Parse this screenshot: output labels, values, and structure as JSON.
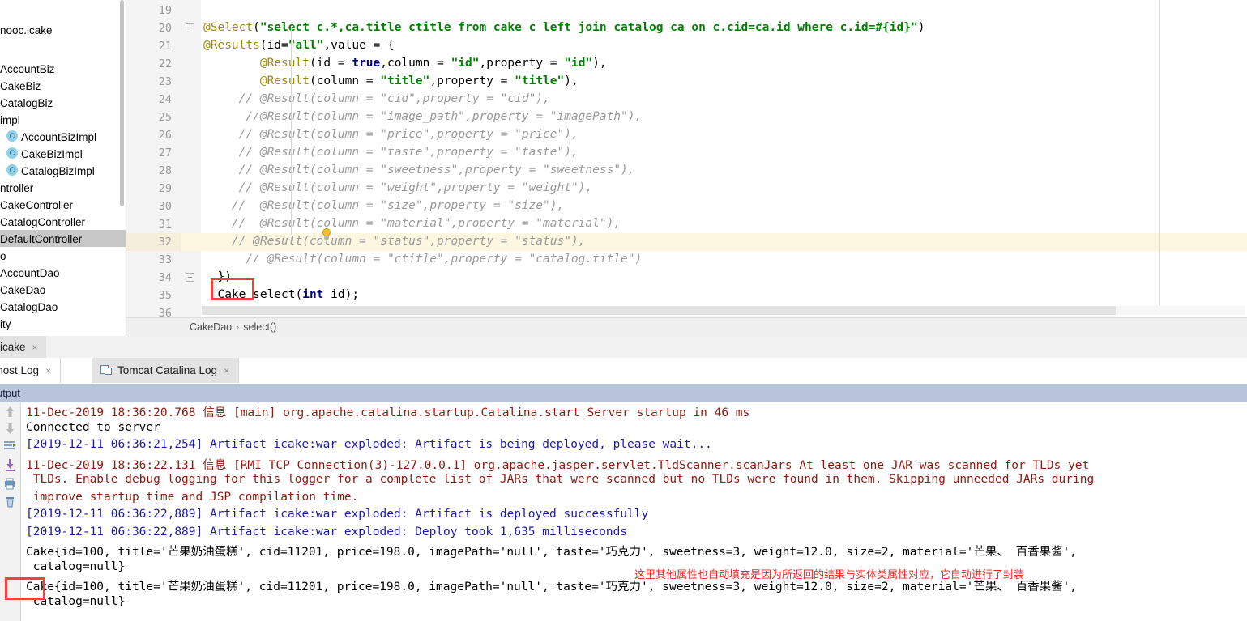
{
  "project_tree": {
    "scrollbar": "vertical-scrollbar",
    "items": [
      {
        "label": "nooc.icake",
        "icon": "",
        "selected": false,
        "indent": 0
      },
      {
        "label": "AccountBiz",
        "icon": "",
        "selected": false,
        "indent": 0
      },
      {
        "label": "CakeBiz",
        "icon": "",
        "selected": false,
        "indent": 0
      },
      {
        "label": "CatalogBiz",
        "icon": "",
        "selected": false,
        "indent": 0
      },
      {
        "label": "impl",
        "icon": "",
        "selected": false,
        "indent": 0
      },
      {
        "label": "AccountBizImpl",
        "icon": "C",
        "selected": false,
        "indent": 1
      },
      {
        "label": "CakeBizImpl",
        "icon": "C",
        "selected": false,
        "indent": 1
      },
      {
        "label": "CatalogBizImpl",
        "icon": "C",
        "selected": false,
        "indent": 1
      },
      {
        "label": "ntroller",
        "icon": "",
        "selected": false,
        "indent": 0
      },
      {
        "label": "CakeController",
        "icon": "",
        "selected": false,
        "indent": 0
      },
      {
        "label": "CatalogController",
        "icon": "",
        "selected": false,
        "indent": 0
      },
      {
        "label": "DefaultController",
        "icon": "",
        "selected": true,
        "indent": 0
      },
      {
        "label": "o",
        "icon": "",
        "selected": false,
        "indent": 0
      },
      {
        "label": "AccountDao",
        "icon": "",
        "selected": false,
        "indent": 0
      },
      {
        "label": "CakeDao",
        "icon": "",
        "selected": false,
        "indent": 0
      },
      {
        "label": "CatalogDao",
        "icon": "",
        "selected": false,
        "indent": 0
      },
      {
        "label": "ity",
        "icon": "",
        "selected": false,
        "indent": 0
      }
    ]
  },
  "editor": {
    "first_line_number": 19,
    "last_line_number": 36,
    "highlighted_line": 32,
    "line_numbers": [
      19,
      20,
      21,
      22,
      23,
      24,
      25,
      26,
      27,
      28,
      29,
      30,
      31,
      32,
      33,
      34,
      35,
      36
    ],
    "lines": [
      {
        "n": 19,
        "text": ""
      },
      {
        "n": 20,
        "text": "@Select(\"select c.*,ca.title ctitle from cake c left join catalog ca on c.cid=ca.id where c.id=#{id}\")"
      },
      {
        "n": 21,
        "text": "@Results(id=\"all\",value = {"
      },
      {
        "n": 22,
        "text": "        @Result(id = true,column = \"id\",property = \"id\"),"
      },
      {
        "n": 23,
        "text": "        @Result(column = \"title\",property = \"title\"),"
      },
      {
        "n": 24,
        "text": "     // @Result(column = \"cid\",property = \"cid\"),"
      },
      {
        "n": 25,
        "text": "      //@Result(column = \"image_path\",property = \"imagePath\"),"
      },
      {
        "n": 26,
        "text": "     // @Result(column = \"price\",property = \"price\"),"
      },
      {
        "n": 27,
        "text": "     // @Result(column = \"taste\",property = \"taste\"),"
      },
      {
        "n": 28,
        "text": "     // @Result(column = \"sweetness\",property = \"sweetness\"),"
      },
      {
        "n": 29,
        "text": "     // @Result(column = \"weight\",property = \"weight\"),"
      },
      {
        "n": 30,
        "text": "    //  @Result(column = \"size\",property = \"size\"),"
      },
      {
        "n": 31,
        "text": "    //  @Result(column = \"material\",property = \"material\"),"
      },
      {
        "n": 32,
        "text": "    // @Result(column = \"status\",property = \"status\"),"
      },
      {
        "n": 33,
        "text": "      // @Result(column = \"ctitle\",property = \"catalog.title\")"
      },
      {
        "n": 34,
        "text": "  })"
      },
      {
        "n": 35,
        "text": "  Cake select(int id);"
      },
      {
        "n": 36,
        "text": ""
      }
    ],
    "annotation_box_label": "Cake",
    "bulb_icon": "lightbulb-intention-icon",
    "breadcrumb": {
      "class_name": "CakeDao",
      "separator": "›",
      "method_name": "select()"
    }
  },
  "file_tab": {
    "label": "icake",
    "close": "×"
  },
  "console_tabs": [
    {
      "label": "calhost Log",
      "close": "×",
      "active": false,
      "icon": ""
    },
    {
      "label": "Tomcat Catalina Log",
      "close": "×",
      "active": true,
      "icon": "tomcat-log-icon"
    }
  ],
  "output_header": {
    "title": "utput"
  },
  "console_toolbar": {
    "icons": [
      "scroll-up-icon",
      "scroll-down-icon",
      "soft-wrap-icon",
      "scroll-to-end-icon",
      "print-icon",
      "clear-all-icon"
    ]
  },
  "console": {
    "lines": [
      {
        "color": "red",
        "text": "11-Dec-2019 18:36:20.768 信息 [main] org.apache.catalina.startup.Catalina.start Server startup in 46 ms"
      },
      {
        "color": "black",
        "text": "Connected to server"
      },
      {
        "color": "blue",
        "text": "[2019-12-11 06:36:21,254] Artifact icake:war exploded: Artifact is being deployed, please wait..."
      },
      {
        "color": "red",
        "text": "11-Dec-2019 18:36:22.131 信息 [RMI TCP Connection(3)-127.0.0.1] org.apache.jasper.servlet.TldScanner.scanJars At least one JAR was scanned for TLDs yet"
      },
      {
        "color": "red",
        "text": " TLDs. Enable debug logging for this logger for a complete list of JARs that were scanned but no TLDs were found in them. Skipping unneeded JARs during"
      },
      {
        "color": "red",
        "text": " improve startup time and JSP compilation time."
      },
      {
        "color": "blue",
        "text": "[2019-12-11 06:36:22,889] Artifact icake:war exploded: Artifact is deployed successfully"
      },
      {
        "color": "blue",
        "text": "[2019-12-11 06:36:22,889] Artifact icake:war exploded: Deploy took 1,635 milliseconds"
      },
      {
        "color": "black",
        "text": "Cake{id=100, title='芒果奶油蛋糕', cid=11201, price=198.0, imagePath='null', taste='巧克力', sweetness=3, weight=12.0, size=2, material='芒果、 百香果酱',"
      },
      {
        "color": "black",
        "text": " catalog=null}"
      },
      {
        "color": "black",
        "text": "Cake{id=100, title='芒果奶油蛋糕', cid=11201, price=198.0, imagePath='null', taste='巧克力', sweetness=3, weight=12.0, size=2, material='芒果、 百香果酱',"
      },
      {
        "color": "black",
        "text": " catalog=null}"
      }
    ],
    "annotation_note": "这里其他属性也自动填充是因为所返回的结果与实体类属性对应，它自动进行了封装",
    "annotation_box_label": "Cake"
  },
  "colors": {
    "annotation_red": "#f5403f",
    "note_red": "#ff1f1f",
    "log_red": "#8b1a10",
    "log_blue": "#1a1aa8",
    "output_header_bg": "#b8c4d9",
    "selection_gray": "#c8c8c8",
    "highlight_yellow": "#fdf6e0",
    "class_icon_blue": "#8fd1e8"
  }
}
